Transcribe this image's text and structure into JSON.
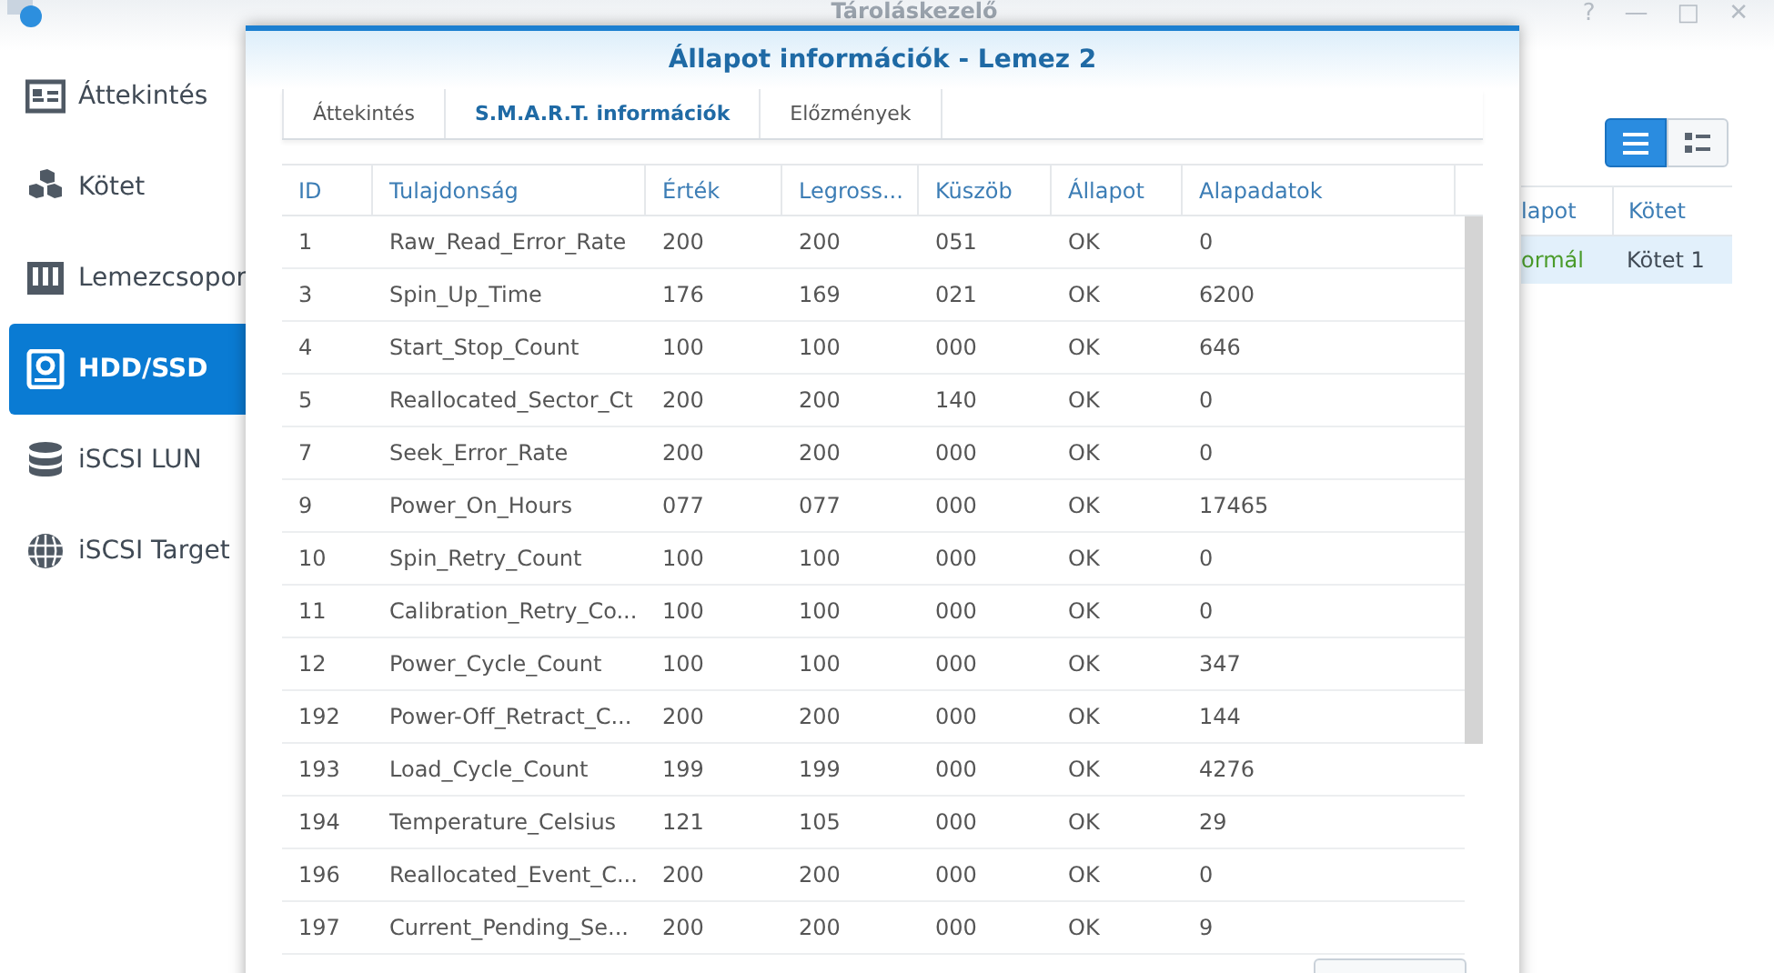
{
  "window": {
    "title": "Tároláskezelő",
    "controls": [
      "?",
      "—",
      "□",
      "✕"
    ]
  },
  "sidebar": {
    "items": [
      {
        "label": "Áttekintés",
        "kind": "overview",
        "selected": false
      },
      {
        "label": "Kötet",
        "kind": "cubes",
        "selected": false
      },
      {
        "label": "Lemezcsopor",
        "kind": "bars",
        "selected": false
      },
      {
        "label": "HDD/SSD",
        "kind": "disk",
        "selected": true
      },
      {
        "label": "iSCSI LUN",
        "kind": "db",
        "selected": false
      },
      {
        "label": "iSCSI Target",
        "kind": "globe",
        "selected": false
      }
    ]
  },
  "main": {
    "view_toggles": [
      {
        "kind": "list",
        "selected": true
      },
      {
        "kind": "detail",
        "selected": false
      }
    ],
    "table": {
      "columns": [
        "lapot",
        "Kötet"
      ],
      "rows": [
        {
          "cells": [
            "ormál",
            "Kötet 1"
          ],
          "selected": true
        }
      ]
    }
  },
  "dialog": {
    "title": "Állapot információk - Lemez 2",
    "tabs": [
      {
        "label": "Áttekintés",
        "selected": false
      },
      {
        "label": "S.M.A.R.T. információk",
        "selected": true
      },
      {
        "label": "Előzmények",
        "selected": false
      }
    ],
    "table": {
      "columns": [
        "ID",
        "Tulajdonság",
        "Érték",
        "Legross...",
        "Küszöb",
        "Állapot",
        "Alapadatok"
      ],
      "rows": [
        [
          "1",
          "Raw_Read_Error_Rate",
          "200",
          "200",
          "051",
          "OK",
          "0"
        ],
        [
          "3",
          "Spin_Up_Time",
          "176",
          "169",
          "021",
          "OK",
          "6200"
        ],
        [
          "4",
          "Start_Stop_Count",
          "100",
          "100",
          "000",
          "OK",
          "646"
        ],
        [
          "5",
          "Reallocated_Sector_Ct",
          "200",
          "200",
          "140",
          "OK",
          "0"
        ],
        [
          "7",
          "Seek_Error_Rate",
          "200",
          "200",
          "000",
          "OK",
          "0"
        ],
        [
          "9",
          "Power_On_Hours",
          "077",
          "077",
          "000",
          "OK",
          "17465"
        ],
        [
          "10",
          "Spin_Retry_Count",
          "100",
          "100",
          "000",
          "OK",
          "0"
        ],
        [
          "11",
          "Calibration_Retry_Co...",
          "100",
          "100",
          "000",
          "OK",
          "0"
        ],
        [
          "12",
          "Power_Cycle_Count",
          "100",
          "100",
          "000",
          "OK",
          "347"
        ],
        [
          "192",
          "Power-Off_Retract_C...",
          "200",
          "200",
          "000",
          "OK",
          "144"
        ],
        [
          "193",
          "Load_Cycle_Count",
          "199",
          "199",
          "000",
          "OK",
          "4276"
        ],
        [
          "194",
          "Temperature_Celsius",
          "121",
          "105",
          "000",
          "OK",
          "29"
        ],
        [
          "196",
          "Reallocated_Event_C...",
          "200",
          "200",
          "000",
          "OK",
          "0"
        ],
        [
          "197",
          "Current_Pending_Se...",
          "200",
          "200",
          "000",
          "OK",
          "9"
        ]
      ]
    }
  }
}
